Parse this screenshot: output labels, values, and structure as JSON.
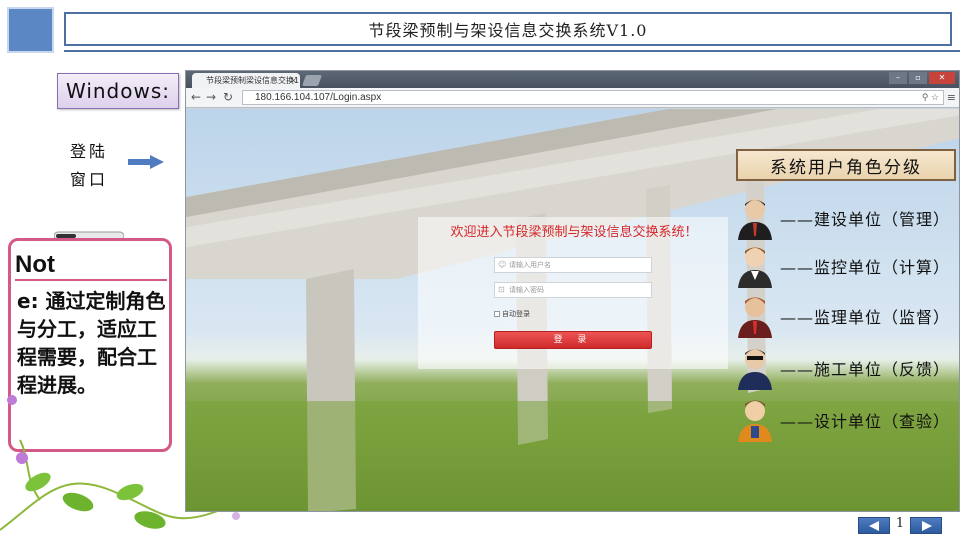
{
  "slide": {
    "title": "节段梁预制与架设信息交换系统V1.0",
    "platform_label": "Windows:",
    "login_window_label": "登陆\n窗口",
    "note": {
      "head": "Not",
      "body": "e:  通过定制角色与分工，适应工程需要，配合工程进展。"
    },
    "page_number": "1"
  },
  "browser": {
    "tab_title": "节段梁预制梁设信息交换1",
    "url": "180.166.104.107/Login.aspx",
    "window_buttons": [
      "–",
      "▫",
      "✕"
    ]
  },
  "login": {
    "welcome": "欢迎进入节段梁预制与架设信息交换系统！",
    "username_placeholder": "请输入用户名",
    "password_placeholder": "请输入密码",
    "auto_login_label": "自动登录",
    "submit_label": "登 录"
  },
  "roles": {
    "title": "系统用户角色分级",
    "items": [
      {
        "label": "——建设单位（管理）"
      },
      {
        "label": "——监控单位（计算）"
      },
      {
        "label": "——监理单位（监督）"
      },
      {
        "label": "——施工单位（反馈）"
      },
      {
        "label": "——设计单位（查验）"
      }
    ]
  }
}
